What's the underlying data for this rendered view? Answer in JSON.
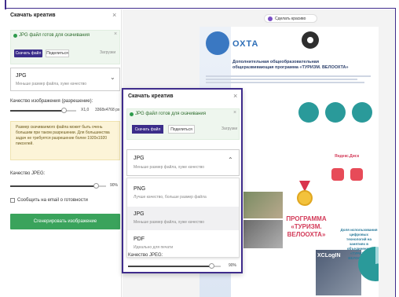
{
  "left_panel": {
    "title": "Скачать креатив",
    "close": "×",
    "status_text": "JPG файл готов для скачивания",
    "status_close": "×",
    "download_label": "Скачать файл",
    "share_label": "Поделиться",
    "more_label": "Загрузки",
    "format_title": "JPG",
    "format_sub": "Меньше размер файла, хуже качество",
    "format_chevron": "⌄",
    "quality_label": "Качество изображения (разрешение):",
    "quality_fraction": 0.82,
    "scale_value": "X1,0",
    "resolution_value": "3368x4768 px",
    "warning_text": "Размер скачиваемого файла может быть очень большим при таком разрешении. Для большинства задач не требуется разрешение более 1920x1920 пикселей.",
    "jpeg_label": "Качество JPEG:",
    "jpeg_fraction": 0.9,
    "jpeg_value": "90%",
    "notify_label": "Сообщить на email о готовности",
    "generate_label": "Сгенерировать изображение"
  },
  "canvas": {
    "beautify_label": "Сделать красиво",
    "poster_brand": "ОХТА",
    "poster_title": "Дополнительная общеобразовательная общеразвивающая программа «ТУРИЗМ. ВЕЛООХТА»",
    "program_text": "ПРОГРАММА «ТУРИЗМ. ВЕЛООХТА»",
    "yandex_text": "Яндекс.Диск",
    "photo_text": "XCLogIN",
    "pie_label": "Доля использования цифровых технологий на занятиях в объединении «ТУРИЗМ. ВЕЛООХТА»"
  },
  "modal": {
    "title": "Скачать креатив",
    "close": "×",
    "status_text": "JPG файл готов для скачивания",
    "status_close": "×",
    "download_label": "Скачать файл",
    "share_label": "Поделиться",
    "more_label": "Загрузки",
    "format_title": "JPG",
    "format_sub": "Меньше размер файла, хуже качество",
    "format_chevron": "⌃",
    "options": [
      {
        "title": "PNG",
        "sub": "Лучше качество, больше размер файла",
        "selected": false
      },
      {
        "title": "JPG",
        "sub": "Меньше размер файла, хуже качество",
        "selected": true
      },
      {
        "title": "PDF",
        "sub": "Идеально для печати",
        "selected": false
      }
    ],
    "jpeg_label": "Качество JPEG:",
    "jpeg_value": "90%"
  },
  "colors": {
    "accent_purple": "#3f2c8c",
    "button_purple": "#3b2d8a",
    "success_green": "#3aa35c",
    "teal": "#2a9a9a",
    "red": "#d33b59"
  },
  "icons": {
    "close": "close-icon",
    "status_dot": "check-circle-icon",
    "chevron_down": "chevron-down-icon",
    "chevron_up": "chevron-up-icon",
    "beautify": "magic-wand-icon"
  }
}
